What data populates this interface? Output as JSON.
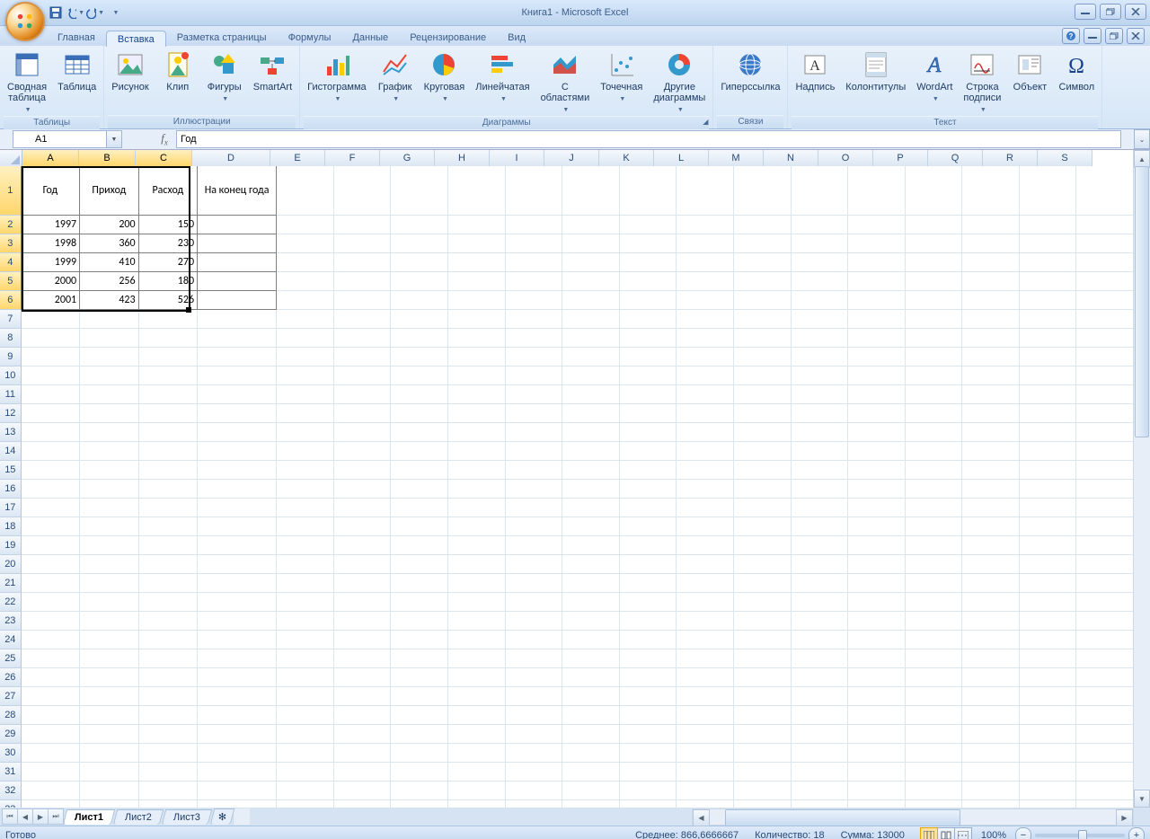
{
  "window": {
    "title": "Книга1 - Microsoft Excel"
  },
  "qat": {
    "tooltip_save": "Сохранить",
    "tooltip_undo": "Отменить",
    "tooltip_redo": "Повторить"
  },
  "tabs": {
    "items": [
      "Главная",
      "Вставка",
      "Разметка страницы",
      "Формулы",
      "Данные",
      "Рецензирование",
      "Вид"
    ],
    "active_index": 1
  },
  "ribbon": {
    "groups": [
      {
        "label": "Таблицы",
        "buttons": [
          {
            "name": "Сводная\nтаблица",
            "dd": true,
            "icon": "pivot"
          },
          {
            "name": "Таблица",
            "dd": false,
            "icon": "table"
          }
        ]
      },
      {
        "label": "Иллюстрации",
        "buttons": [
          {
            "name": "Рисунок",
            "icon": "picture"
          },
          {
            "name": "Клип",
            "icon": "clip"
          },
          {
            "name": "Фигуры",
            "dd": true,
            "icon": "shapes"
          },
          {
            "name": "SmartArt",
            "icon": "smartart"
          }
        ]
      },
      {
        "label": "Диаграммы",
        "launcher": true,
        "buttons": [
          {
            "name": "Гистограмма",
            "dd": true,
            "icon": "bar"
          },
          {
            "name": "График",
            "dd": true,
            "icon": "line"
          },
          {
            "name": "Круговая",
            "dd": true,
            "icon": "pie"
          },
          {
            "name": "Линейчатая",
            "dd": true,
            "icon": "hbar"
          },
          {
            "name": "С\nобластями",
            "dd": true,
            "icon": "area"
          },
          {
            "name": "Точечная",
            "dd": true,
            "icon": "scatter"
          },
          {
            "name": "Другие\nдиаграммы",
            "dd": true,
            "icon": "donut"
          }
        ]
      },
      {
        "label": "Связи",
        "buttons": [
          {
            "name": "Гиперссылка",
            "icon": "hyperlink"
          }
        ]
      },
      {
        "label": "Текст",
        "buttons": [
          {
            "name": "Надпись",
            "icon": "textbox"
          },
          {
            "name": "Колонтитулы",
            "icon": "headerfooter"
          },
          {
            "name": "WordArt",
            "dd": true,
            "icon": "wordart"
          },
          {
            "name": "Строка\nподписи",
            "dd": true,
            "icon": "sigline"
          },
          {
            "name": "Объект",
            "icon": "object"
          },
          {
            "name": "Символ",
            "icon": "symbol"
          }
        ]
      }
    ]
  },
  "namebox": {
    "value": "A1"
  },
  "formula": {
    "value": "Год"
  },
  "columns": [
    "A",
    "B",
    "C",
    "D",
    "E",
    "F",
    "G",
    "H",
    "I",
    "J",
    "K",
    "L",
    "M",
    "N",
    "O",
    "P",
    "Q",
    "R",
    "S"
  ],
  "sel_cols": [
    "A",
    "B",
    "C"
  ],
  "rows_visible": 33,
  "sel_rows": [
    1,
    2,
    3,
    4,
    5,
    6
  ],
  "table": {
    "headers": [
      "Год",
      "Приход",
      "Расход",
      "На конец года"
    ],
    "data": [
      [
        "1997",
        "200",
        "150",
        ""
      ],
      [
        "1998",
        "360",
        "230",
        ""
      ],
      [
        "1999",
        "410",
        "270",
        ""
      ],
      [
        "2000",
        "256",
        "180",
        ""
      ],
      [
        "2001",
        "423",
        "526",
        ""
      ]
    ]
  },
  "sheet_tabs": {
    "items": [
      "Лист1",
      "Лист2",
      "Лист3"
    ],
    "active_index": 0
  },
  "status": {
    "ready": "Готово",
    "avg_label": "Среднее:",
    "avg_value": "866,6666667",
    "count_label": "Количество:",
    "count_value": "18",
    "sum_label": "Сумма:",
    "sum_value": "13000",
    "zoom": "100%"
  },
  "chart_data": {
    "type": "table",
    "title": "",
    "columns": [
      "Год",
      "Приход",
      "Расход",
      "На конец года"
    ],
    "rows": [
      [
        1997,
        200,
        150,
        null
      ],
      [
        1998,
        360,
        230,
        null
      ],
      [
        1999,
        410,
        270,
        null
      ],
      [
        2000,
        256,
        180,
        null
      ],
      [
        2001,
        423,
        526,
        null
      ]
    ]
  }
}
